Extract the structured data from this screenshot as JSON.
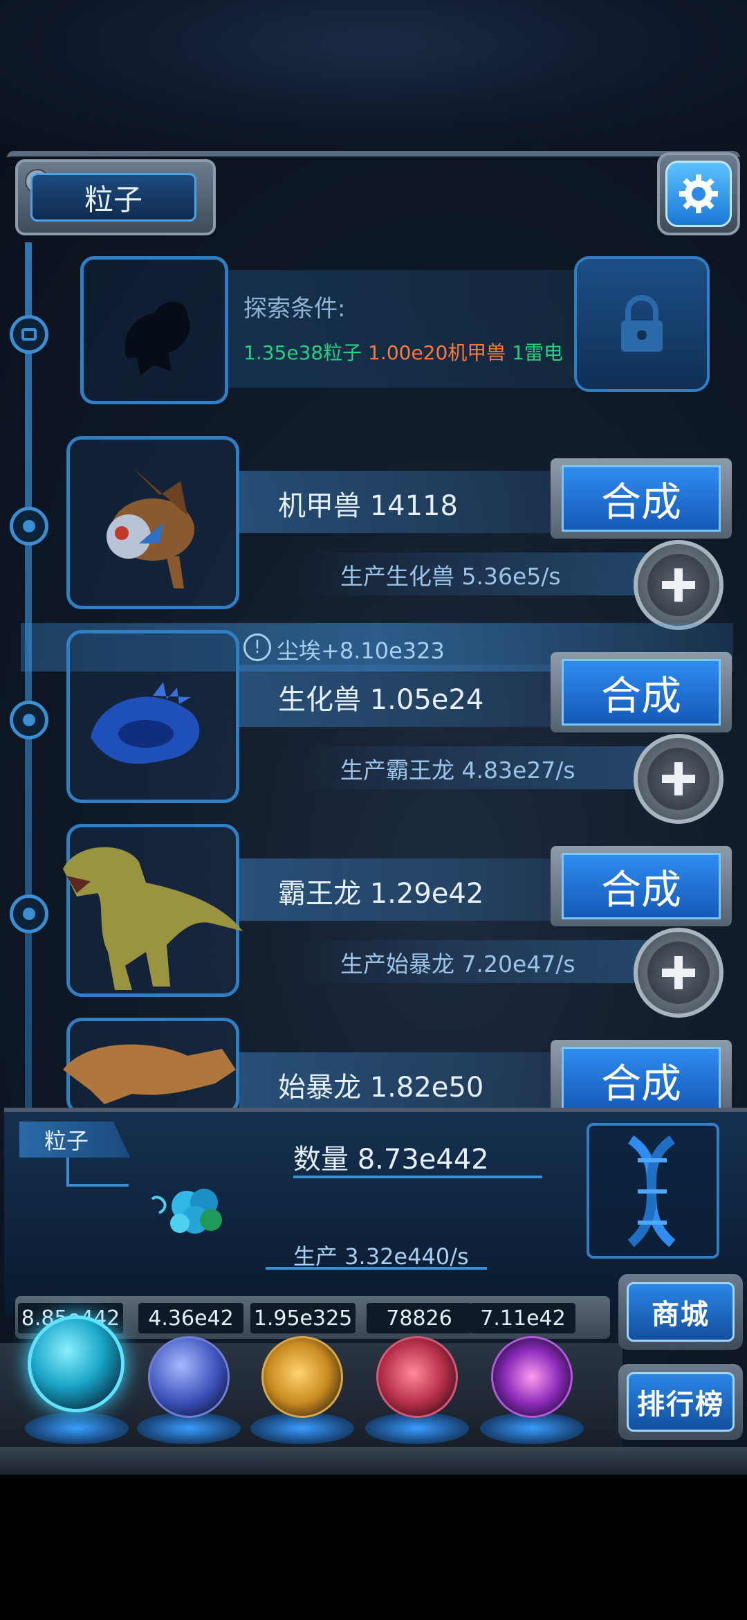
{
  "header": {
    "title": "粒子"
  },
  "explore": {
    "label": "探索条件:",
    "req1": "1.35e38粒子",
    "req2": "1.00e20机甲兽",
    "req3": "1雷电"
  },
  "creatures": [
    {
      "name": "机甲兽 14118",
      "production": "生产生化兽 5.36e5/s",
      "synth_label": "合成"
    },
    {
      "name": "生化兽 1.05e24",
      "production": "生产霸王龙 4.83e27/s",
      "synth_label": "合成"
    },
    {
      "name": "霸王龙 1.29e42",
      "production": "生产始暴龙 7.20e47/s",
      "synth_label": "合成"
    },
    {
      "name": "始暴龙 1.82e50",
      "synth_label": "合成"
    }
  ],
  "notice": {
    "text": "尘埃+8.10e323",
    "icon": "exclamation-icon"
  },
  "info": {
    "tag": "粒子",
    "quantity": "数量 8.73e442",
    "rate": "生产 3.32e440/s"
  },
  "resources": [
    {
      "value": "8.85e442",
      "icon": "particle-orb"
    },
    {
      "value": "4.36e42",
      "icon": "lightning-orb"
    },
    {
      "value": "1.95e325",
      "icon": "dust-orb"
    },
    {
      "value": "78826",
      "icon": "brain-orb"
    },
    {
      "value": "7.11e42",
      "icon": "vortex-orb"
    }
  ],
  "side": {
    "shop_label": "商城",
    "rank_label": "排行榜"
  },
  "colors": {
    "accent": "#2f8cf0",
    "green": "#26d07c",
    "orange": "#ff7a3a"
  }
}
